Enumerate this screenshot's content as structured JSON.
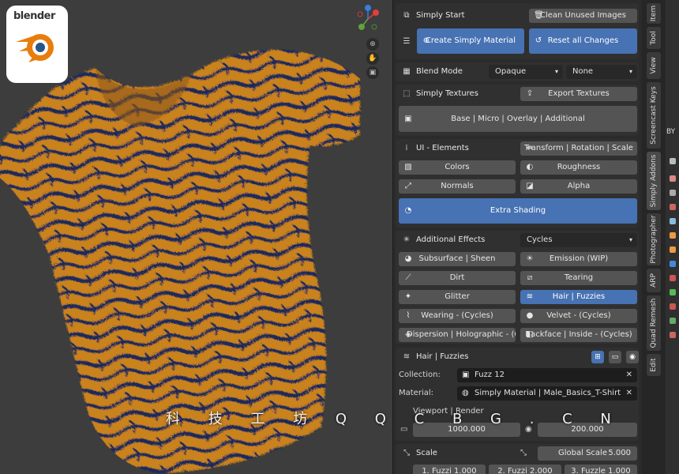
{
  "watermark": "科 技 工 坊  Q Q C B G . C N",
  "logo": {
    "word": "blender"
  },
  "colors": {
    "accent": "#4772b3",
    "panel": "#2b2b2b",
    "button": "#545454",
    "fur": "#c9821f",
    "stripe": "#1b2a5a"
  },
  "simply_start": {
    "title": "Simply Start",
    "clean_label": "Clean Unused Images",
    "create_label": "Create Simply Material",
    "reset_label": "Reset all Changes"
  },
  "blend_mode": {
    "label": "Blend Mode",
    "value": "Opaque",
    "value2": "None"
  },
  "simply_textures": {
    "title": "Simply Textures",
    "export_label": "Export Textures",
    "layers_label": "Base | Micro | Overlay | Additional"
  },
  "ui_elements": {
    "title": "UI - Elements",
    "transform_label": "Transform | Rotation | Scale",
    "colors_label": "Colors",
    "roughness_label": "Roughness",
    "normals_label": "Normals",
    "alpha_label": "Alpha",
    "extra_label": "Extra Shading"
  },
  "additional_effects": {
    "title": "Additional Effects",
    "engine": "Cycles",
    "buttons": [
      "Subsurface | Sheen",
      "Emission (WIP)",
      "Dirt",
      "Tearing",
      "Glitter",
      "Hair | Fuzzies",
      "Wearing - (Cycles)",
      "Velvet - (Cycles)",
      "Dispersion | Holographic - (C...",
      "Backface | Inside - (Cycles)"
    ]
  },
  "hair": {
    "title": "Hair | Fuzzies",
    "collection_label": "Collection:",
    "collection_value": "Fuzz 12",
    "material_label": "Material:",
    "material_value": "Simply Material | Male_Basics_T-Shirt",
    "viewport_label": "Viewport | Render",
    "viewport_value": "1000.000",
    "render_value": "200.000"
  },
  "scale": {
    "title": "Scale",
    "global_label": "Global Scale",
    "global_value": "5.000",
    "fuzz1": "1. Fuzzi    1.000",
    "fuzz2": "2. Fuzzi    2.000",
    "fuzz3": "3. Fuzzle    1.000"
  },
  "tabs": [
    "Item",
    "Tool",
    "View",
    "Screencast Keys",
    "Simply Addons",
    "Photographer",
    "ARP",
    "Quad Remesh",
    "Edit"
  ],
  "right_strip": {
    "label": "BY"
  }
}
